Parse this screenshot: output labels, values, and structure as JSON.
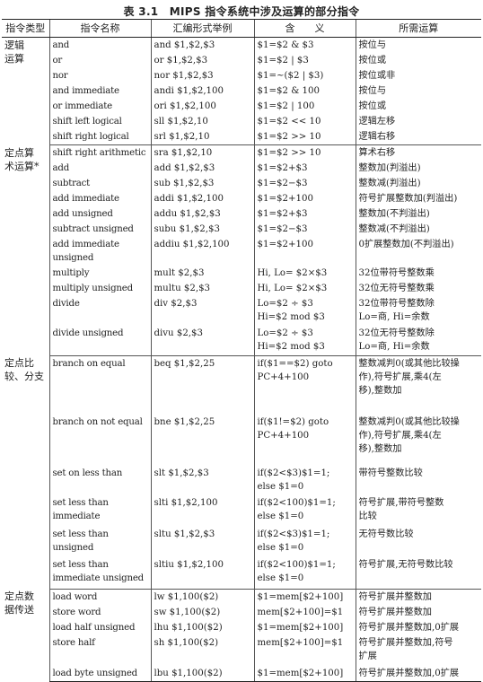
{
  "caption": "表 3.1　MIPS 指令系统中涉及运算的部分指令",
  "headers": {
    "type": "指令类型",
    "name": "指令名称",
    "example": "汇编形式举例",
    "meaning": "含　　义",
    "op": "所需运算"
  },
  "groups": [
    {
      "category": [
        "逻辑",
        "运算"
      ],
      "rows": [
        {
          "name": [
            "and"
          ],
          "example": [
            "and $1,$2,$3"
          ],
          "meaning": [
            "$1=$2 & $3"
          ],
          "op": [
            "按位与"
          ]
        },
        {
          "name": [
            "or"
          ],
          "example": [
            "or $1,$2,$3"
          ],
          "meaning": [
            "$1=$2 | $3"
          ],
          "op": [
            "按位或"
          ]
        },
        {
          "name": [
            "nor"
          ],
          "example": [
            "nor $1,$2,$3"
          ],
          "meaning": [
            "$1=~($2 | $3)"
          ],
          "op": [
            "按位或非"
          ]
        },
        {
          "name": [
            "and immediate"
          ],
          "example": [
            "andi $1,$2,100"
          ],
          "meaning": [
            "$1=$2 & 100"
          ],
          "op": [
            "按位与"
          ]
        },
        {
          "name": [
            "or immediate"
          ],
          "example": [
            "ori $1,$2,100"
          ],
          "meaning": [
            "$1=$2 | 100"
          ],
          "op": [
            "按位或"
          ]
        },
        {
          "name": [
            "shift left logical"
          ],
          "example": [
            "sll $1,$2,10"
          ],
          "meaning": [
            "$1=$2 << 10"
          ],
          "op": [
            "逻辑左移"
          ]
        },
        {
          "name": [
            "shift right logical"
          ],
          "example": [
            "srl $1,$2,10"
          ],
          "meaning": [
            "$1=$2 >> 10"
          ],
          "op": [
            "逻辑右移"
          ]
        }
      ]
    },
    {
      "category": [
        "定点算",
        "术运算*"
      ],
      "rows": [
        {
          "name": [
            "shift right arithmetic"
          ],
          "example": [
            "sra $1,$2,10"
          ],
          "meaning": [
            "$1=$2 >> 10"
          ],
          "op": [
            "算术右移"
          ]
        },
        {
          "name": [
            "add"
          ],
          "example": [
            "add $1,$2,$3"
          ],
          "meaning": [
            "$1=$2+$3"
          ],
          "op": [
            "整数加(判溢出)"
          ]
        },
        {
          "name": [
            "subtract"
          ],
          "example": [
            "sub $1,$2,$3"
          ],
          "meaning": [
            "$1=$2−$3"
          ],
          "op": [
            "整数减(判溢出)"
          ]
        },
        {
          "name": [
            "add immediate"
          ],
          "example": [
            "addi $1,$2,100"
          ],
          "meaning": [
            "$1=$2+100"
          ],
          "op": [
            "符号扩展整数加(判溢出)"
          ]
        },
        {
          "name": [
            "add unsigned"
          ],
          "example": [
            "addu $1,$2,$3"
          ],
          "meaning": [
            "$1=$2+$3"
          ],
          "op": [
            "整数加(不判溢出)"
          ]
        },
        {
          "name": [
            "subtract unsigned"
          ],
          "example": [
            "subu $1,$2,$3"
          ],
          "meaning": [
            "$1=$2−$3"
          ],
          "op": [
            "整数减(不判溢出)"
          ]
        },
        {
          "name": [
            "add immediate unsigned"
          ],
          "example": [
            "addiu $1,$2,100"
          ],
          "meaning": [
            "$1=$2+100"
          ],
          "op": [
            "0扩展整数加(不判溢出)"
          ]
        },
        {
          "name": [
            "multiply"
          ],
          "example": [
            "mult $2,$3"
          ],
          "meaning": [
            "Hi, Lo= $2×$3"
          ],
          "op": [
            "32位带符号整数乘"
          ]
        },
        {
          "name": [
            "multiply unsigned"
          ],
          "example": [
            "multu $2,$3"
          ],
          "meaning": [
            "Hi, Lo= $2×$3"
          ],
          "op": [
            "32位无符号整数乘"
          ]
        },
        {
          "name": [
            "divide"
          ],
          "example": [
            "div $2,$3"
          ],
          "meaning": [
            "Lo=$2 ÷ $3",
            "Hi=$2 mod $3"
          ],
          "op": [
            "32位带符号整数除",
            "Lo=商, Hi=余数"
          ]
        },
        {
          "name": [
            "divide unsigned"
          ],
          "example": [
            "divu $2,$3"
          ],
          "meaning": [
            "Lo=$2 ÷ $3",
            "Hi=$2 mod $3"
          ],
          "op": [
            "32位无符号整数除",
            "Lo=商, Hi=余数"
          ]
        }
      ]
    },
    {
      "category": [
        "定点比",
        "较、分支"
      ],
      "rows": [
        {
          "name": [
            "branch on equal"
          ],
          "example": [
            "beq $1,$2,25"
          ],
          "meaning": [
            "if($1==$2) goto",
            "PC+4+100"
          ],
          "op": [
            "整数减判0(或其他比较操",
            "作),符号扩展,乘4(左",
            "移),整数加"
          ]
        },
        {
          "name": [
            "branch on not equal"
          ],
          "example": [
            "bne $1,$2,25"
          ],
          "meaning": [
            "if($1!=$2) goto",
            "PC+4+100"
          ],
          "op": [
            "整数减判0(或其他比较操",
            "作),符号扩展,乘4(左",
            "移),整数加"
          ]
        },
        {
          "name": [
            "set on less than"
          ],
          "example": [
            "slt $1,$2,$3"
          ],
          "meaning": [
            "if($2<$3)$1=1;",
            "else $1=0"
          ],
          "op": [
            "带符号整数比较"
          ]
        },
        {
          "name": [
            "set less than",
            "immediate"
          ],
          "example": [
            "slti $1,$2,100"
          ],
          "meaning": [
            "if($2<100)$1=1;",
            "else $1=0"
          ],
          "op": [
            "符号扩展,带符号整数",
            "比较"
          ]
        },
        {
          "name": [
            "set less than",
            "unsigned"
          ],
          "example": [
            "sltu $1,$2,$3"
          ],
          "meaning": [
            "if($2<$3)$1=1;",
            "else $1=0"
          ],
          "op": [
            "无符号数比较"
          ]
        },
        {
          "name": [
            "set less than",
            "immediate unsigned"
          ],
          "example": [
            "sltiu $1,$2,100"
          ],
          "meaning": [
            "if($2<100)$1=1;",
            "else $1=0"
          ],
          "op": [
            "符号扩展,无符号数比较"
          ]
        }
      ]
    },
    {
      "category": [
        "定点数",
        "据传送"
      ],
      "rows": [
        {
          "name": [
            "load word"
          ],
          "example": [
            "lw $1,100($2)"
          ],
          "meaning": [
            "$1=mem[$2+100]"
          ],
          "op": [
            "符号扩展并整数加"
          ]
        },
        {
          "name": [
            "store word"
          ],
          "example": [
            "sw $1,100($2)"
          ],
          "meaning": [
            "mem[$2+100]=$1"
          ],
          "op": [
            "符号扩展并整数加"
          ]
        },
        {
          "name": [
            "load half unsigned"
          ],
          "example": [
            "lhu $1,100($2)"
          ],
          "meaning": [
            "$1=mem[$2+100]"
          ],
          "op": [
            "符号扩展并整数加,0扩展"
          ]
        },
        {
          "name": [
            "store half"
          ],
          "example": [
            "sh $1,100($2)"
          ],
          "meaning": [
            "mem[$2+100]=$1"
          ],
          "op": [
            "符号扩展并整数加,符号",
            "扩展"
          ]
        },
        {
          "name": [
            "load byte unsigned"
          ],
          "example": [
            "lbu $1,100($2)"
          ],
          "meaning": [
            "$1=mem[$2+100]"
          ],
          "op": [
            "符号扩展并整数加,0扩展"
          ]
        }
      ]
    }
  ]
}
